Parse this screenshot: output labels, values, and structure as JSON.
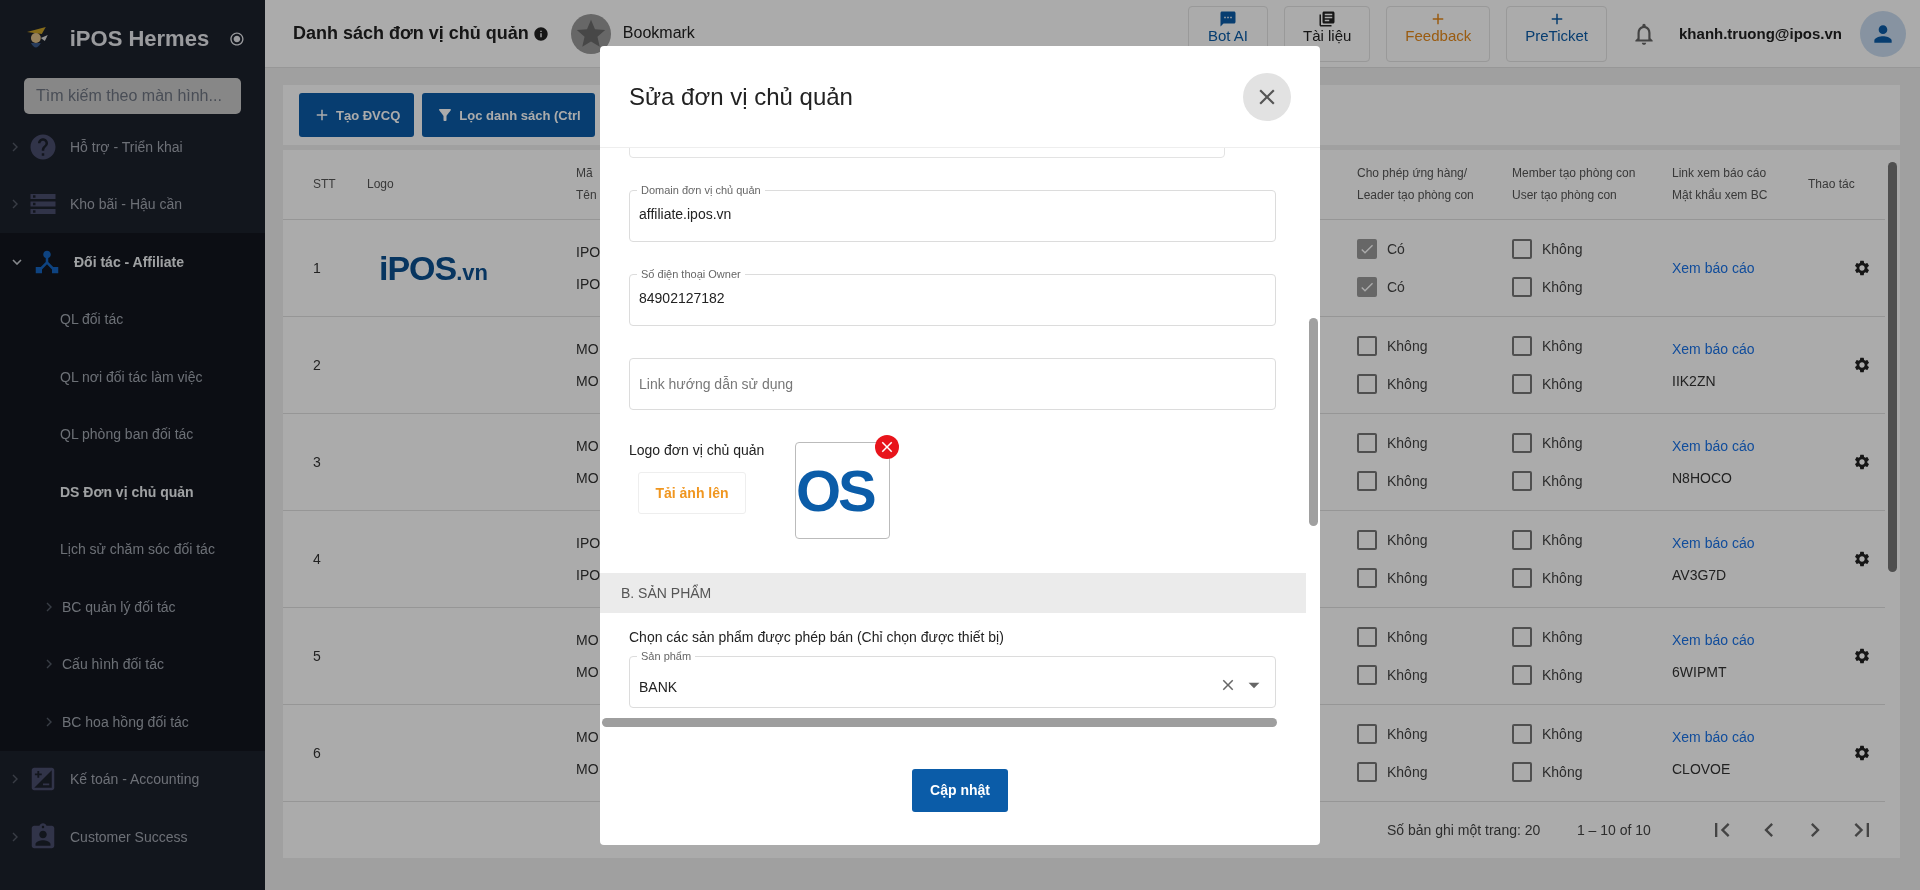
{
  "app": {
    "name": "iPOS Hermes",
    "search_placeholder": "Tìm kiếm theo màn hình..."
  },
  "sidebar": {
    "items": [
      {
        "label": "Hỗ trợ - Triển khai",
        "expanded": false
      },
      {
        "label": "Kho bãi - Hậu cần",
        "expanded": false
      },
      {
        "label": "Đối tác - Affiliate",
        "expanded": true,
        "children": [
          {
            "label": "QL đối tác",
            "selected": false
          },
          {
            "label": "QL nơi đối tác làm việc",
            "selected": false
          },
          {
            "label": "QL phòng ban đối tác",
            "selected": false
          },
          {
            "label": "DS Đơn vị chủ quản",
            "selected": true
          },
          {
            "label": "Lịch sử chăm sóc đối tác",
            "selected": false
          },
          {
            "label": "BC quản lý đối tác",
            "selected": false,
            "expanded": false
          },
          {
            "label": "Cấu hình đối tác",
            "selected": false,
            "expanded": false
          },
          {
            "label": "BC hoa hồng đối tác",
            "selected": false,
            "expanded": false
          }
        ]
      },
      {
        "label": "Kế toán - Accounting",
        "expanded": false
      },
      {
        "label": "Customer Success",
        "expanded": false
      }
    ]
  },
  "header": {
    "title": "Danh sách đơn vị chủ quản",
    "bookmark": "Bookmark",
    "buttons": [
      {
        "label": "Bot AI",
        "kind": "chat"
      },
      {
        "label": "Tài liệu",
        "kind": "docs"
      },
      {
        "label": "Feedback",
        "kind": "feedback"
      },
      {
        "label": "PreTicket",
        "kind": "ticket"
      }
    ],
    "user": "khanh.truong@ipos.vn"
  },
  "toolbar": {
    "buttons": [
      "Tạo ĐVCQ",
      "Lọc danh sách (Ctrl"
    ]
  },
  "table": {
    "columns": [
      {
        "lines": [
          "STT"
        ]
      },
      {
        "lines": [
          "Logo"
        ]
      },
      {
        "lines": [
          "Mã",
          "Tên"
        ]
      },
      {
        "lines": [
          "Cho phép ứng hàng/",
          "Leader tạo phòng con"
        ]
      },
      {
        "lines": [
          "Member tạo phòng con",
          "User tạo phòng con"
        ]
      },
      {
        "lines": [
          "Link xem báo cáo",
          "Mật khẩu xem BC"
        ]
      },
      {
        "lines": [
          "Thao tác"
        ]
      }
    ],
    "rows": [
      {
        "stt": "1",
        "logo": {
          "name": "iPOS",
          "suffix": ".vn"
        },
        "code": "IPO",
        "name": "IPO",
        "checks": [
          [
            {
              "label": "Có",
              "checked": true
            },
            {
              "label": "Có",
              "checked": true
            }
          ],
          [
            {
              "label": "Không",
              "checked": false
            },
            {
              "label": "Không",
              "checked": false
            }
          ]
        ],
        "link": "Xem báo cáo"
      },
      {
        "stt": "2",
        "code": "MO",
        "name": "MO",
        "checks": [
          [
            {
              "label": "Không",
              "checked": false
            },
            {
              "label": "Không",
              "checked": false
            }
          ],
          [
            {
              "label": "Không",
              "checked": false
            },
            {
              "label": "Không",
              "checked": false
            }
          ]
        ],
        "link": "Xem báo cáo",
        "password": "IIK2ZN"
      },
      {
        "stt": "3",
        "code": "MO",
        "name": "MO",
        "checks": [
          [
            {
              "label": "Không",
              "checked": false
            },
            {
              "label": "Không",
              "checked": false
            }
          ],
          [
            {
              "label": "Không",
              "checked": false
            },
            {
              "label": "Không",
              "checked": false
            }
          ]
        ],
        "link": "Xem báo cáo",
        "password": "N8HOCO"
      },
      {
        "stt": "4",
        "code": "IPO",
        "name": "IPO",
        "checks": [
          [
            {
              "label": "Không",
              "checked": false
            },
            {
              "label": "Không",
              "checked": false
            }
          ],
          [
            {
              "label": "Không",
              "checked": false
            },
            {
              "label": "Không",
              "checked": false
            }
          ]
        ],
        "link": "Xem báo cáo",
        "password": "AV3G7D"
      },
      {
        "stt": "5",
        "code": "MO",
        "name": "MO",
        "checks": [
          [
            {
              "label": "Không",
              "checked": false
            },
            {
              "label": "Không",
              "checked": false
            }
          ],
          [
            {
              "label": "Không",
              "checked": false
            },
            {
              "label": "Không",
              "checked": false
            }
          ]
        ],
        "link": "Xem báo cáo",
        "password": "6WIPMT"
      },
      {
        "stt": "6",
        "code": "MO",
        "name": "MO",
        "checks": [
          [
            {
              "label": "Không",
              "checked": false
            },
            {
              "label": "Không",
              "checked": false
            }
          ],
          [
            {
              "label": "Không",
              "checked": false
            },
            {
              "label": "Không",
              "checked": false
            }
          ]
        ],
        "link": "Xem báo cáo",
        "password": "CLOVOE"
      }
    ],
    "footer": {
      "page_size": "Số bản ghi một trang: 20",
      "range": "1 – 10 of 10"
    }
  },
  "modal": {
    "title": "Sửa đơn vị chủ quản",
    "fields": [
      {
        "label": "Domain đơn vị chủ quản",
        "value": "affiliate.ipos.vn"
      },
      {
        "label": "Số điện thoại Owner",
        "value": "84902127182"
      },
      {
        "placeholder": "Link hướng dẫn sử dụng"
      }
    ],
    "logo_label": "Logo đơn vị chủ quản",
    "upload_button": "Tải ảnh lên",
    "logo_preview": "OS",
    "section": "B. SẢN PHẨM",
    "products_label": "Chọn các sản phẩm được phép bán (Chỉ chọn được thiết bị)",
    "product_select": {
      "label": "Sản phẩm",
      "value": "BANK"
    },
    "submit": "Cập nhật"
  }
}
